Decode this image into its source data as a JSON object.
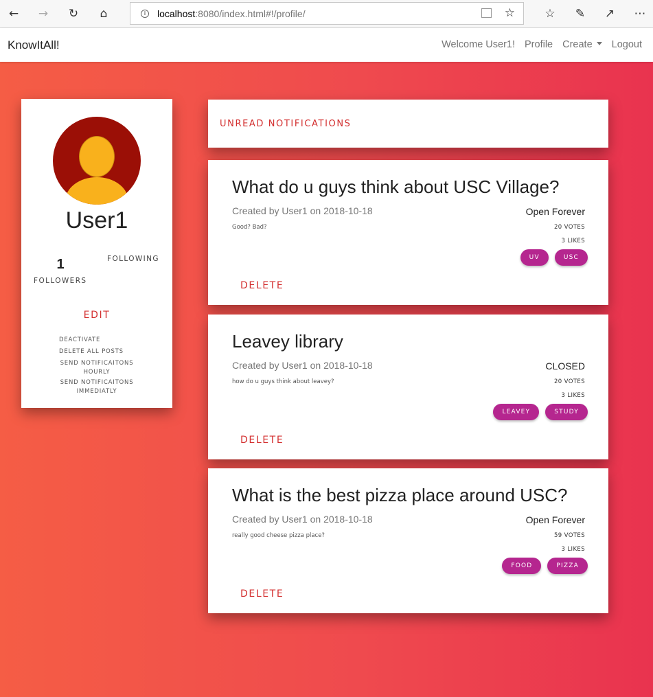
{
  "browser": {
    "url_host": "localhost",
    "url_path": ":8080/index.html#!/profile/"
  },
  "navbar": {
    "brand": "KnowItAll!",
    "welcome": "Welcome User1!",
    "profile": "Profile",
    "create": "Create",
    "logout": "Logout"
  },
  "profile": {
    "username": "User1",
    "followers_count": "1",
    "followers_label": "FOLLOWERS",
    "following_label": "FOLLOWING",
    "edit": "EDIT",
    "deactivate": "DEACTIVATE",
    "delete_all_posts": "DELETE ALL POSTS",
    "send_hourly_1": "SEND NOTIFICAITONS",
    "send_hourly_2": "HOURLY",
    "send_immediate_1": "SEND NOTIFICAITONS",
    "send_immediate_2": "IMMEDIATLY"
  },
  "notifications": {
    "label": "UNREAD NOTIFICATIONS"
  },
  "posts": [
    {
      "title": "What do u guys think about USC Village?",
      "meta": "Created by User1 on 2018-10-18",
      "description": "Good? Bad?",
      "status": "Open Forever",
      "votes": "20 VOTES",
      "likes": "3 LIKES",
      "tags": [
        "UV",
        "USC"
      ],
      "delete": "DELETE"
    },
    {
      "title": "Leavey library",
      "meta": "Created by User1 on 2018-10-18",
      "description": "how do u guys think about leavey?",
      "status": "CLOSED",
      "votes": "20 VOTES",
      "likes": "3 LIKES",
      "tags": [
        "LEAVEY",
        "STUDY"
      ],
      "delete": "DELETE"
    },
    {
      "title": "What is the best pizza place around USC?",
      "meta": "Created by User1 on 2018-10-18",
      "description": "really good cheese pizza place?",
      "status": "Open Forever",
      "votes": "59 VOTES",
      "likes": "3 LIKES",
      "tags": [
        "FOOD",
        "PIZZA"
      ],
      "delete": "DELETE"
    }
  ]
}
